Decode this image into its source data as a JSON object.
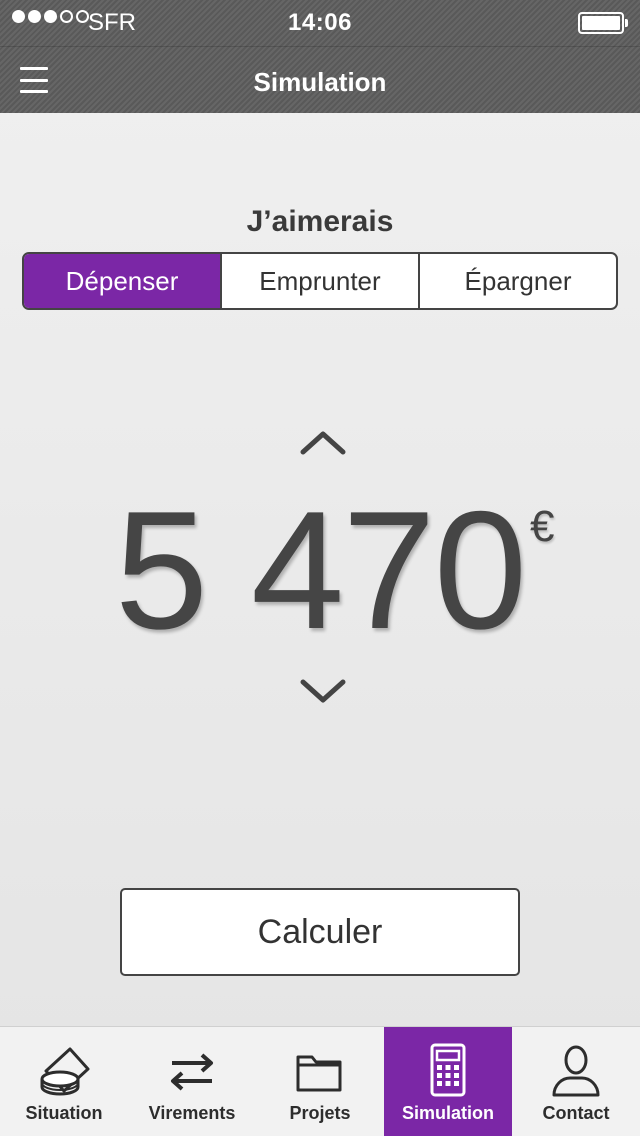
{
  "status_bar": {
    "carrier": "SFR",
    "time": "14:06",
    "signal_bars_filled": 3,
    "signal_bars_total": 5
  },
  "nav": {
    "title": "Simulation",
    "menu_icon": "hamburger-menu-icon"
  },
  "main": {
    "prompt": "J’aimerais",
    "segments": [
      {
        "label": "Dépenser",
        "active": true
      },
      {
        "label": "Emprunter",
        "active": false
      },
      {
        "label": "Épargner",
        "active": false
      }
    ],
    "amount": "5 470",
    "currency": "€",
    "calculate_label": "Calculer"
  },
  "tabbar": {
    "items": [
      {
        "label": "Situation",
        "icon": "coins-icon",
        "active": false
      },
      {
        "label": "Virements",
        "icon": "transfer-arrows-icon",
        "active": false
      },
      {
        "label": "Projets",
        "icon": "folder-icon",
        "active": false
      },
      {
        "label": "Simulation",
        "icon": "calculator-icon",
        "active": true
      },
      {
        "label": "Contact",
        "icon": "person-icon",
        "active": false
      }
    ]
  },
  "colors": {
    "accent": "#7b27a6",
    "header": "#5e5e5e",
    "text": "#454545"
  }
}
